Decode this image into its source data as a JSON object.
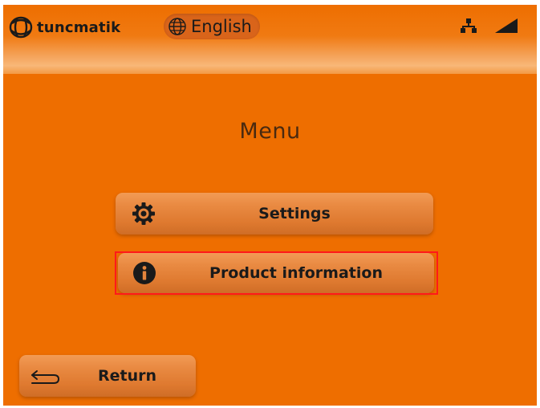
{
  "header": {
    "brand": "tuncmatik",
    "language": "English",
    "icons": {
      "logo": "globe-logo-icon",
      "language": "globe-icon",
      "network": "network-icon",
      "signal": "signal-strength-icon"
    }
  },
  "menu": {
    "title": "Menu",
    "items": [
      {
        "label": "Settings",
        "icon": "gear-icon"
      },
      {
        "label": "Product information",
        "icon": "info-icon",
        "highlighted": true
      }
    ]
  },
  "footer": {
    "return_label": "Return",
    "return_icon": "return-arrow-icon"
  },
  "colors": {
    "background": "#ee6e00",
    "button": "#e4843c",
    "highlight": "#ff1a1a",
    "text": "#1a1a1a"
  }
}
